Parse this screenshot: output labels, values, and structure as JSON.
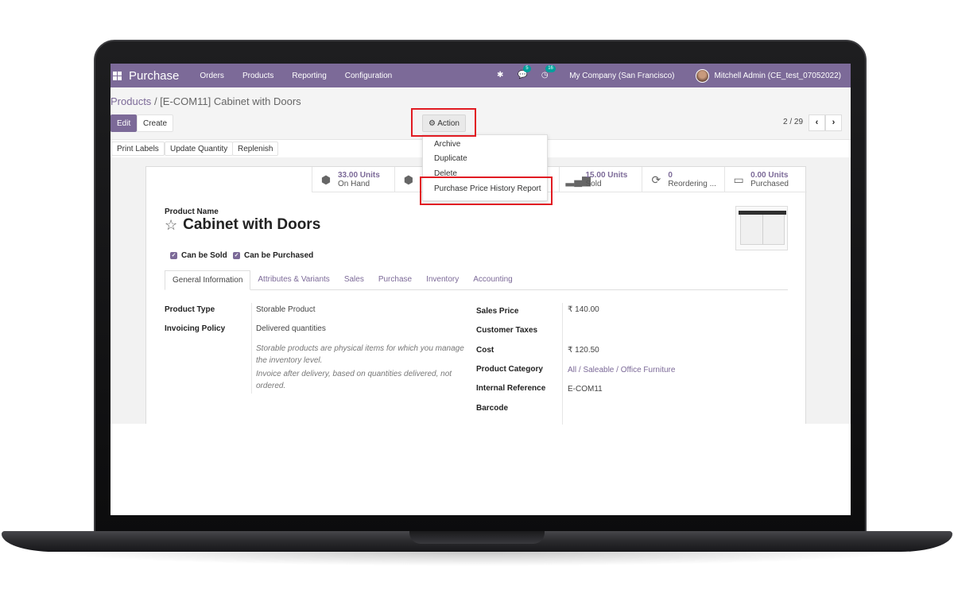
{
  "navbar": {
    "app_name": "Purchase",
    "menu": [
      "Orders",
      "Products",
      "Reporting",
      "Configuration"
    ],
    "chat_badge": "5",
    "activity_badge": "16",
    "company": "My Company (San Francisco)",
    "user": "Mitchell Admin (CE_test_07052022)"
  },
  "breadcrumb": {
    "parent": "Products",
    "current": "[E-COM11] Cabinet with Doors"
  },
  "buttons": {
    "edit": "Edit",
    "create": "Create",
    "action": "Action",
    "print_labels": "Print Labels",
    "update_quantity": "Update Quantity",
    "replenish": "Replenish"
  },
  "pager": {
    "value": "2 / 29"
  },
  "action_menu": [
    "Archive",
    "Duplicate",
    "Delete",
    "Purchase Price History Report"
  ],
  "stats": [
    {
      "value": "33.00 Units",
      "label": "On Hand",
      "icon": "cubes-icon"
    },
    {
      "value": "",
      "label": "",
      "icon": "cubes-icon"
    },
    {
      "value": "",
      "label": "",
      "icon": ""
    },
    {
      "value": "15.00 Units",
      "label": "Sold",
      "icon": "signal-icon"
    },
    {
      "value": "0",
      "label": "Reordering ...",
      "icon": "refresh-icon"
    },
    {
      "value": "0.00 Units",
      "label": "Purchased",
      "icon": "credit-card-icon"
    }
  ],
  "product": {
    "name_label": "Product Name",
    "name": "Cabinet with Doors",
    "can_be_sold": "Can be Sold",
    "can_be_purchased": "Can be Purchased"
  },
  "tabs": [
    "General Information",
    "Attributes & Variants",
    "Sales",
    "Purchase",
    "Inventory",
    "Accounting"
  ],
  "left_fields": {
    "product_type_label": "Product Type",
    "product_type": "Storable Product",
    "invoicing_policy_label": "Invoicing Policy",
    "invoicing_policy": "Delivered quantities",
    "help_line1": "Storable products are physical items for which you manage",
    "help_line2": "the inventory level.",
    "help_line3": "Invoice after delivery, based on quantities delivered, not",
    "help_line4": "ordered."
  },
  "right_fields": {
    "sales_price_label": "Sales Price",
    "sales_price": "₹ 140.00",
    "customer_taxes_label": "Customer Taxes",
    "cost_label": "Cost",
    "cost": "₹ 120.50",
    "product_category_label": "Product Category",
    "product_category": "All / Saleable / Office Furniture",
    "internal_reference_label": "Internal Reference",
    "internal_reference": "E-COM11",
    "barcode_label": "Barcode"
  },
  "colors": {
    "brand": "#7c6a98",
    "highlight": "#e11b22",
    "badge": "#00a09d"
  }
}
